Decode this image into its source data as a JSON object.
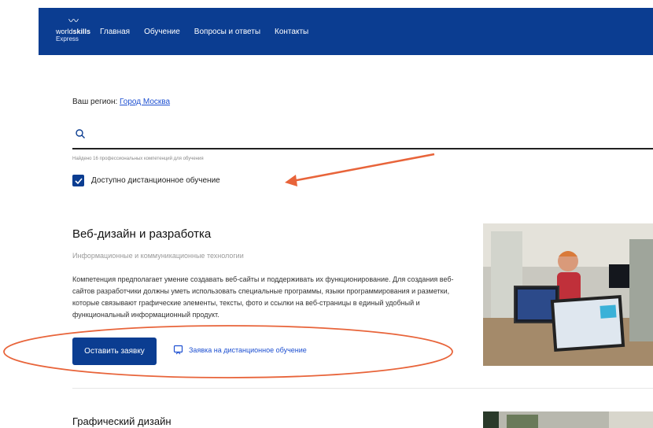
{
  "header": {
    "logo": {
      "mark": "〰",
      "brand_a": "world",
      "brand_b": "skills",
      "brand_sub": "Express"
    },
    "nav": [
      "Главная",
      "Обучение",
      "Вопросы и ответы",
      "Контакты"
    ]
  },
  "region": {
    "label": "Ваш регион:",
    "value": "Город Москва"
  },
  "search": {
    "value": "",
    "icon": "search-icon"
  },
  "found_text": "Найдено 16 профессиональных компетенций для обучения",
  "filter": {
    "label": "Доступно дистанционное обучение",
    "checked": true
  },
  "cards": [
    {
      "title": "Веб-дизайн и разработка",
      "category": "Информационные и коммуникационные технологии",
      "description": "Компетенция предполагает умение создавать веб-сайты и поддерживать их функционирование. Для создания веб-сайтов разработчики должны уметь использовать специальные программы, языки программирования и разметки, которые связывают графические элементы, тексты, фото и ссылки на веб-страницы в единый удобный и функциональный информационный продукт.",
      "apply_label": "Оставить заявку",
      "remote_label": "Заявка на дистанционное обучение"
    },
    {
      "title": "Графический дизайн"
    }
  ],
  "colors": {
    "brand": "#0b3d91",
    "link": "#1e50d1",
    "annotation": "#e8643a"
  }
}
